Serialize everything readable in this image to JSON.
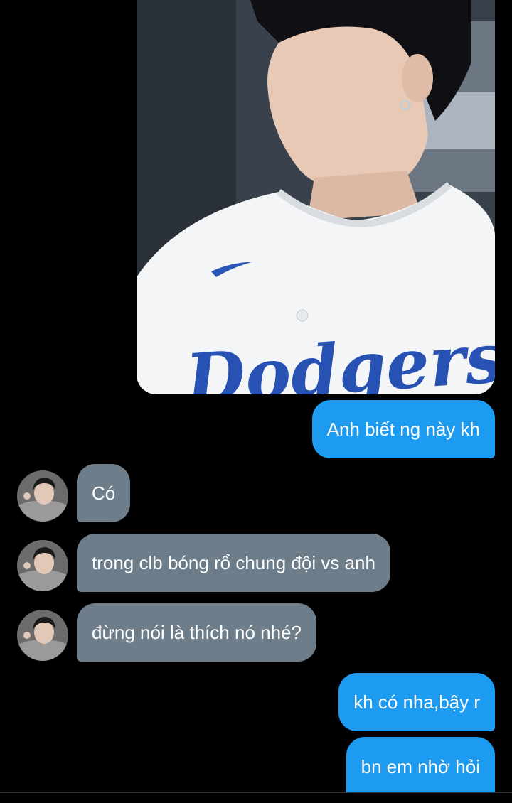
{
  "chat": {
    "shared_photo": {
      "jersey_text": "Dodgers"
    },
    "messages": [
      {
        "direction": "out",
        "text": "Anh biết ng này kh"
      },
      {
        "direction": "in",
        "text": "Có"
      },
      {
        "direction": "in",
        "text": "trong clb bóng rổ chung đội vs anh"
      },
      {
        "direction": "in",
        "text": "đừng nói là thích nó nhé?"
      },
      {
        "direction": "out",
        "text": "kh có nha,bậy r"
      },
      {
        "direction": "out",
        "text": "bn em nhờ hỏi"
      }
    ]
  },
  "colors": {
    "outgoing_bubble": "#1d9bf0",
    "incoming_bubble": "#6e7d8a",
    "background": "#000000"
  }
}
